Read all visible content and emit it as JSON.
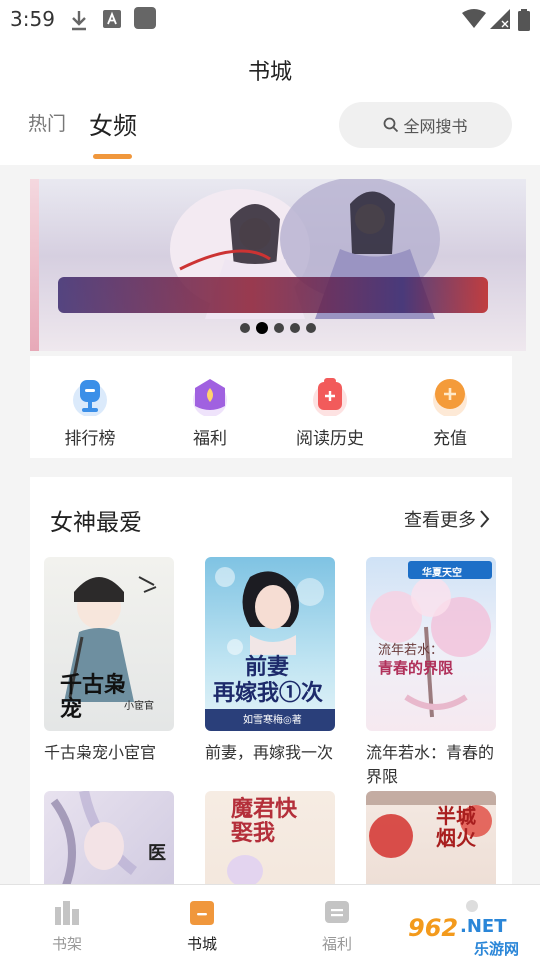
{
  "status_bar": {
    "time": "3:59"
  },
  "header": {
    "title": "书城",
    "tabs": [
      {
        "label": "热门"
      },
      {
        "label": "女频"
      }
    ],
    "search": {
      "label": "全网搜书"
    }
  },
  "banner": {
    "dots": 5,
    "active_dot": 1
  },
  "quick_links": [
    {
      "label": "排行榜",
      "icon": "trophy-icon"
    },
    {
      "label": "福利",
      "icon": "gift-icon"
    },
    {
      "label": "阅读历史",
      "icon": "history-icon"
    },
    {
      "label": "充值",
      "icon": "coin-icon"
    }
  ],
  "section": {
    "title": "女神最爱",
    "more": "查看更多",
    "books": [
      {
        "title": "千古枭宠小宦官",
        "cover_text": "千古枭宠",
        "cover_sub": "小宦官"
      },
      {
        "title": "前妻，再嫁我一次",
        "cover_text": "前妻",
        "cover_text2": "再嫁我①次",
        "cover_sub": "如雪寒梅◎著"
      },
      {
        "title": "流年若水：青春的界限",
        "cover_text": "流年若水：",
        "cover_text2": "青春的界限",
        "cover_sub": "华夏天空"
      },
      {
        "title": "",
        "cover_text": "医"
      },
      {
        "title": "",
        "cover_text": "魔君快娶我"
      },
      {
        "title": "",
        "cover_text": "半城烟火"
      }
    ]
  },
  "bottom_nav": [
    {
      "label": "书架",
      "icon": "bookshelf-icon"
    },
    {
      "label": "书城",
      "icon": "bookstore-icon"
    },
    {
      "label": "福利",
      "icon": "welfare-icon"
    }
  ],
  "watermark": {
    "number": "962",
    "suffix": ".NET",
    "text": "乐游网"
  },
  "colors": {
    "accent": "#f0973c",
    "active_text": "#222222",
    "inactive_text": "#999999"
  }
}
